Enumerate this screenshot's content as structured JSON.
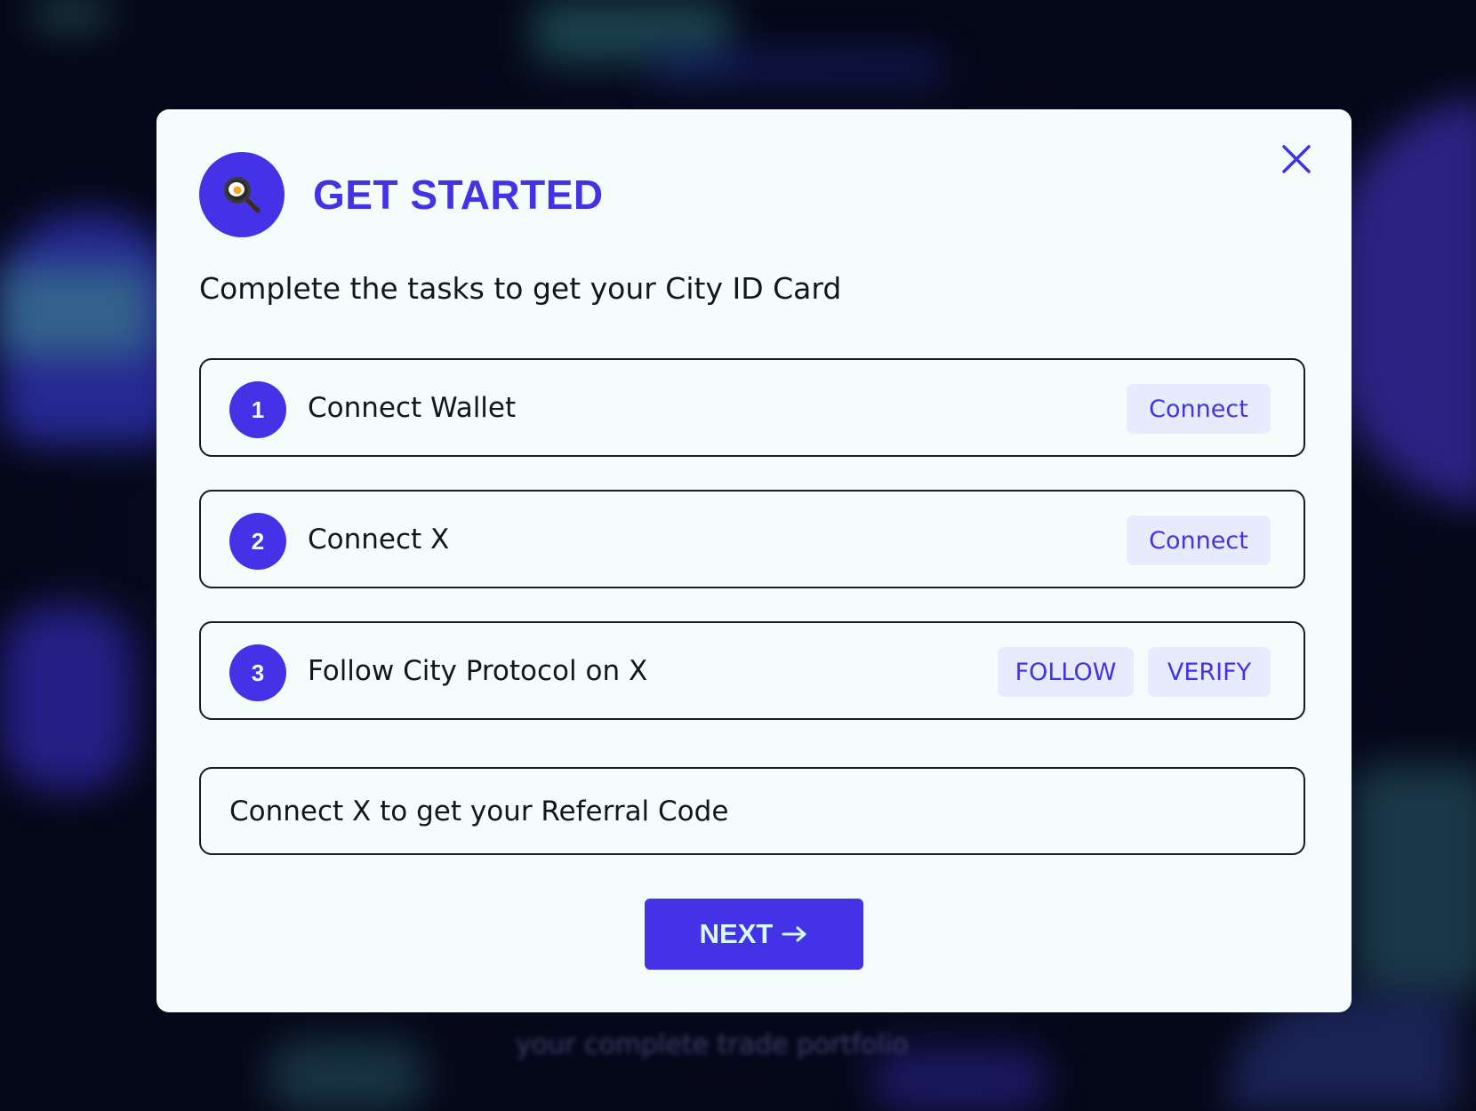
{
  "background": {
    "footer_text": "your complete trade portfolio"
  },
  "modal": {
    "title": "GET STARTED",
    "subtitle": "Complete the tasks to get your City ID Card",
    "logo_icon": "frying-pan-egg-icon",
    "close_icon": "close-icon",
    "tasks": [
      {
        "number": "1",
        "label": "Connect Wallet",
        "actions": [
          "Connect"
        ]
      },
      {
        "number": "2",
        "label": "Connect X",
        "actions": [
          "Connect"
        ]
      },
      {
        "number": "3",
        "label": "Follow City Protocol on X",
        "actions": [
          "FOLLOW",
          "VERIFY"
        ]
      }
    ],
    "referral_text": "Connect X to get your Referral Code",
    "next_label": "NEXT",
    "next_icon": "arrow-right-icon"
  },
  "colors": {
    "accent": "#4433e6",
    "modal_background": "#f4fdfc",
    "action_button_background": "#e6ebfd",
    "next_text": "#d4fbf5",
    "border": "#1a1a24"
  }
}
